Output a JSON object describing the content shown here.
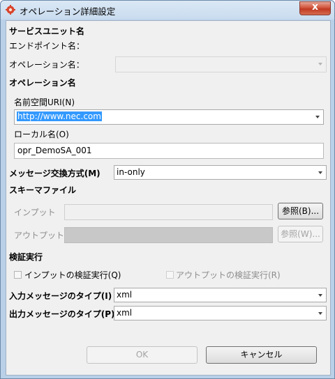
{
  "window": {
    "title": "オペレーション詳細設定",
    "close_symbol": "x"
  },
  "service_unit": {
    "heading": "サービスユニット名",
    "endpoint_label": "エンドポイント名：",
    "operation_label": "オペレーション名：",
    "operation_value": ""
  },
  "operation_name": {
    "heading": "オペレーション名",
    "namespace_label": "名前空間URI(N)",
    "namespace_value": "http://www.nec.com",
    "local_label": "ローカル名(O)",
    "local_value": "opr_DemoSA_001"
  },
  "exchange": {
    "label": "メッセージ交換方式(M)",
    "value": "in-only"
  },
  "schema": {
    "heading": "スキーマファイル",
    "input_label": "インプット",
    "input_value": "",
    "input_browse": "参照(B)...",
    "output_label": "アウトプット",
    "output_value": "",
    "output_browse": "参照(W)..."
  },
  "validation": {
    "heading": "検証実行",
    "input_check": "インプットの検証実行(Q)",
    "output_check": "アウトプットの検証実行(R)",
    "input_checked": false,
    "output_checked": false
  },
  "types": {
    "input_label": "入力メッセージのタイプ(I)",
    "input_value": "xml",
    "output_label": "出力メッセージのタイプ(P)",
    "output_value": "xml"
  },
  "buttons": {
    "ok": "OK",
    "cancel": "キャンセル"
  },
  "colors": {
    "selection": "#3399ff",
    "close": "#c8462c",
    "title_icon": "#d9442b"
  }
}
